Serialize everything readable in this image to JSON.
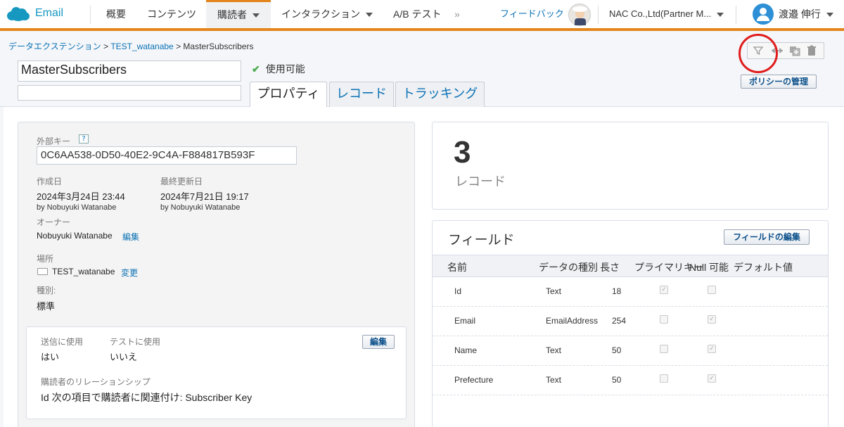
{
  "app": {
    "name": "Email"
  },
  "nav": {
    "items": [
      "概要",
      "コンテンツ",
      "購読者",
      "インタラクション",
      "A/B テスト"
    ],
    "more": "»",
    "feedback": "フィードバック",
    "account": "NAC Co.,Ltd(Partner M...",
    "user": "渡邉 伸行"
  },
  "breadcrumb": {
    "root": "データエクステンション",
    "parent": "TEST_watanabe",
    "current": "MasterSubscribers",
    "sep": " > "
  },
  "extension": {
    "name": "MasterSubscribers",
    "description": "",
    "status": "使用可能"
  },
  "tabs": [
    "プロパティ",
    "レコード",
    "トラッキング"
  ],
  "policy_button": "ポリシーの管理",
  "properties": {
    "external_key_label": "外部キー",
    "help": "?",
    "external_key": "0C6AA538-0D50-40E2-9C4A-F884817B593F",
    "created_label": "作成日",
    "created": "2024年3月24日 23:44",
    "created_by": "by Nobuyuki Watanabe",
    "modified_label": "最終更新日",
    "modified": "2024年7月21日 19:17",
    "modified_by": "by Nobuyuki Watanabe",
    "owner_label": "オーナー",
    "owner": "Nobuyuki Watanabe",
    "edit": "編集",
    "location_label": "場所",
    "location": "TEST_watanabe",
    "change": "変更",
    "type_label": "種別:",
    "type": "標準"
  },
  "usage": {
    "send_label": "送信に使用",
    "send": "はい",
    "test_label": "テストに使用",
    "test": "いいえ",
    "edit": "編集",
    "relation_label": "購読者のリレーションシップ",
    "relation": "Id 次の項目で購読者に関連付け: Subscriber Key"
  },
  "records": {
    "count": "3",
    "label": "レコード"
  },
  "fields": {
    "title": "フィールド",
    "edit_button": "フィールドの編集",
    "headers": [
      "名前",
      "データの種別",
      "長さ",
      "プライマリキー",
      "Null 可能",
      "デフォルト値"
    ],
    "rows": [
      {
        "name": "Id",
        "type": "Text",
        "length": "18",
        "primary": true,
        "nullable": false
      },
      {
        "name": "Email",
        "type": "EmailAddress",
        "length": "254",
        "primary": false,
        "nullable": true
      },
      {
        "name": "Name",
        "type": "Text",
        "length": "50",
        "primary": false,
        "nullable": true
      },
      {
        "name": "Prefecture",
        "type": "Text",
        "length": "50",
        "primary": false,
        "nullable": true
      }
    ]
  },
  "colors": {
    "accent": "#e3851b",
    "link": "#0b72b5",
    "brand": "#1798c1",
    "highlight": "#e01b1b"
  }
}
